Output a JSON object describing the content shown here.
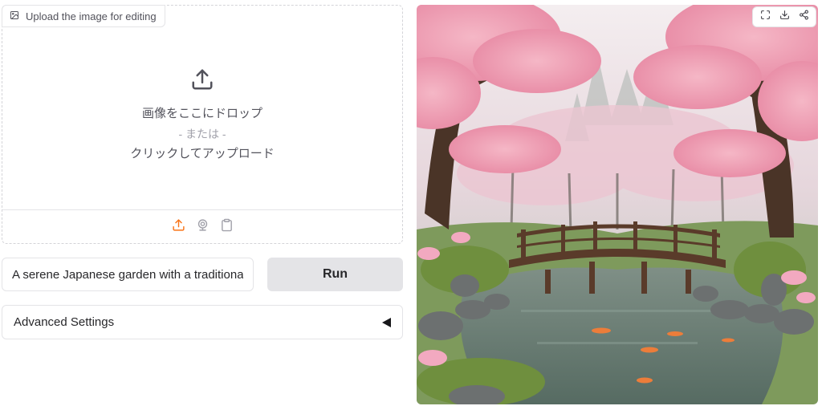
{
  "input_panel": {
    "label": "Upload the image for editing",
    "drop_text": "画像をここにドロップ",
    "or_text": "- または -",
    "click_text": "クリックしてアップロード",
    "sources": [
      {
        "icon": "upload-icon",
        "active": true
      },
      {
        "icon": "webcam-icon",
        "active": false
      },
      {
        "icon": "clipboard-icon",
        "active": false
      }
    ]
  },
  "prompt": {
    "value": "A serene Japanese garden with a traditional wooden bridge",
    "visible_value": "A serene Japanese garden with a traditional v"
  },
  "run_button": {
    "label": "Run"
  },
  "accordion": {
    "label": "Advanced Settings",
    "open": false
  },
  "output_image": {
    "description_icons": [
      "fullscreen-icon",
      "download-icon",
      "share-icon"
    ]
  },
  "colors": {
    "accent": "#f97316",
    "border": "#e4e4e7",
    "button_bg": "#e4e4e7",
    "icon_muted": "#a1a1aa"
  }
}
